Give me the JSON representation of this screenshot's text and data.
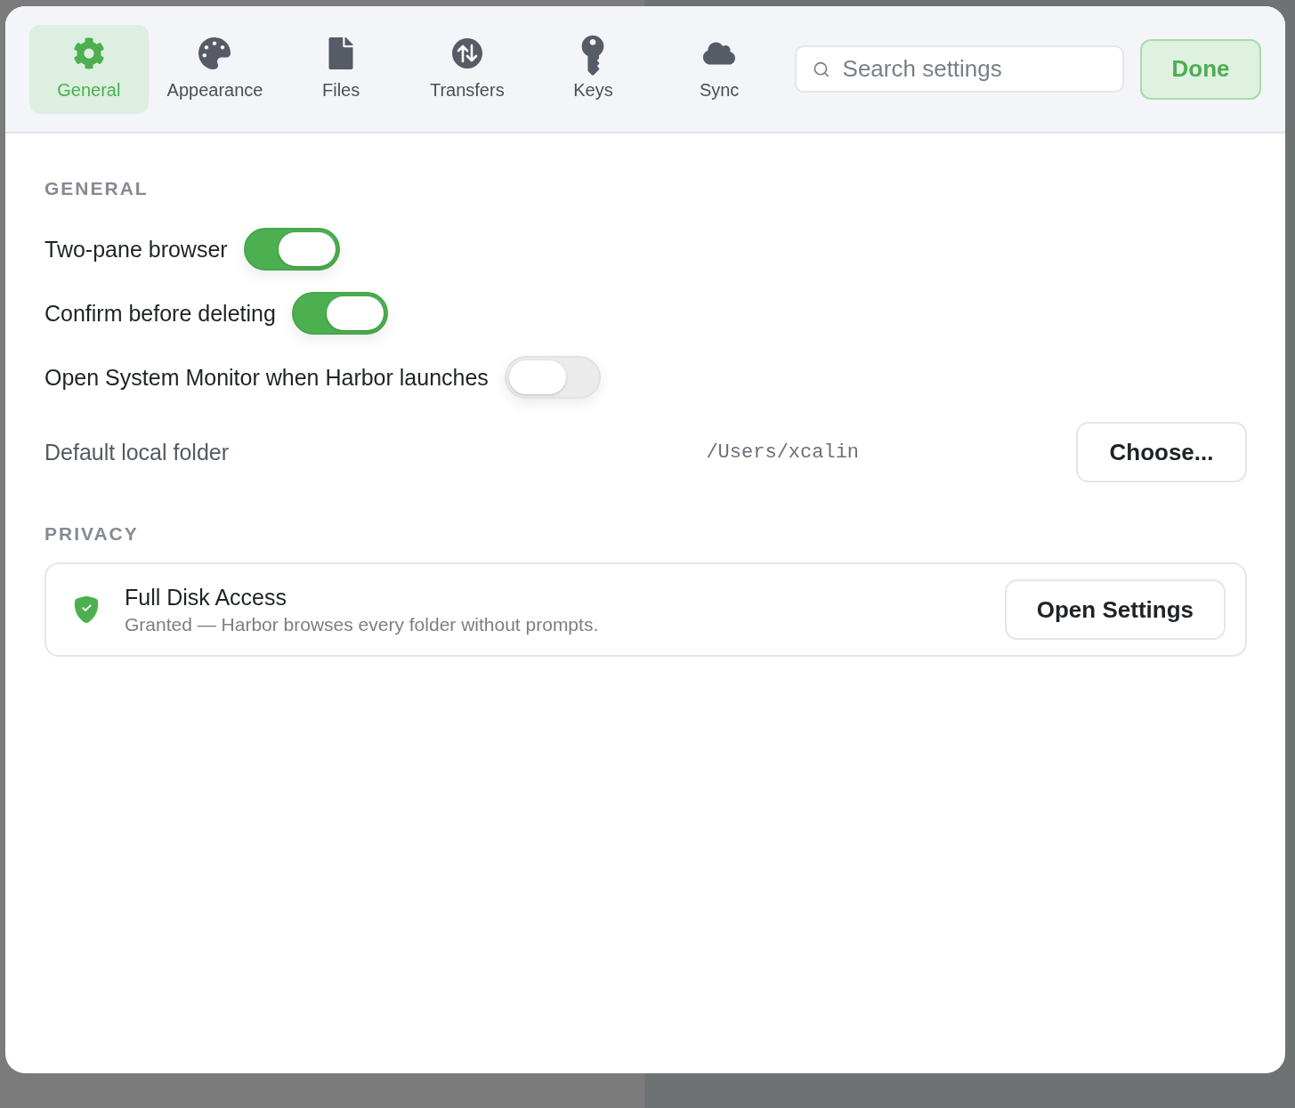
{
  "toolbar": {
    "tabs": [
      {
        "label": "General",
        "selected": true
      },
      {
        "label": "Appearance",
        "selected": false
      },
      {
        "label": "Files",
        "selected": false
      },
      {
        "label": "Transfers",
        "selected": false
      },
      {
        "label": "Keys",
        "selected": false
      },
      {
        "label": "Sync",
        "selected": false
      }
    ],
    "search": {
      "placeholder": "Search settings"
    },
    "done_button": "Done"
  },
  "sections": [
    {
      "heading": "GENERAL",
      "items": [
        {
          "kind": "toggle",
          "label": "Two-pane browser",
          "on": true
        },
        {
          "kind": "toggle",
          "label": "Confirm before deleting",
          "on": true
        },
        {
          "kind": "toggle",
          "label": "Open System Monitor when Harbor launches",
          "on": false
        },
        {
          "kind": "folder",
          "label": "Default local folder",
          "value": "/Users/xcalin",
          "button": "Choose..."
        }
      ]
    },
    {
      "heading": "PRIVACY",
      "items": [
        {
          "kind": "permission",
          "title": "Full Disk Access",
          "description": "Granted — Harbor browses every folder without prompts.",
          "granted": true,
          "button": "Open Settings"
        }
      ]
    }
  ]
}
